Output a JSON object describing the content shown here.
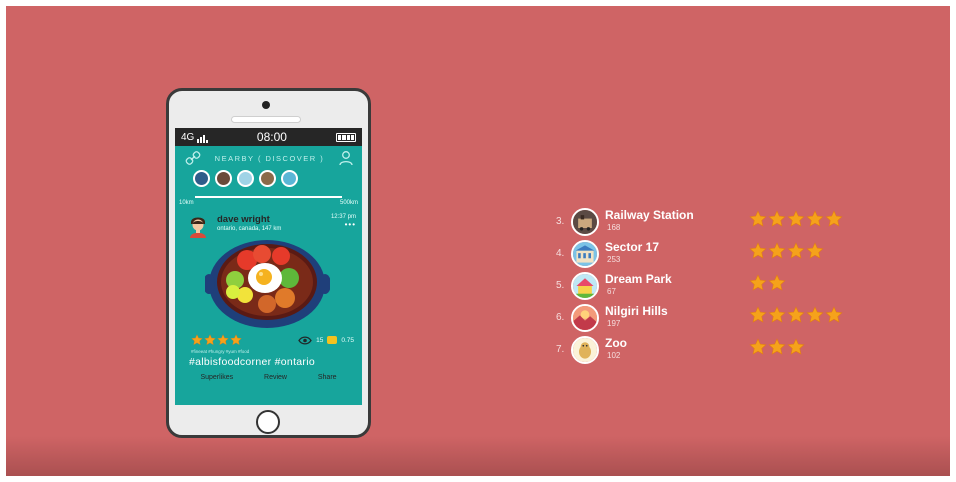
{
  "phone": {
    "status_bar": {
      "network": "4G",
      "time": "08:00"
    },
    "nav": {
      "title": "NEARBY ( DISCOVER )"
    },
    "filter_avatars": [
      "avatar-1",
      "avatar-2",
      "avatar-3",
      "avatar-4",
      "avatar-5"
    ],
    "range": {
      "min_label": "10km",
      "max_label": "500km"
    },
    "post": {
      "user": "dave wright",
      "location": "ontario, canada, 147 km",
      "time": "12:37 pm",
      "more": "•••",
      "rating": 4,
      "views": "15",
      "coins": "0.75",
      "caption": "#fineeat #hungry #yum #food",
      "hashtags": "#albisfoodcorner  #ontario",
      "actions": [
        "Superlikes",
        "Review",
        "Share"
      ]
    }
  },
  "rankings": [
    {
      "rank": "3.",
      "name": "Railway Station",
      "count": "168",
      "stars": 5,
      "icon": "train-icon"
    },
    {
      "rank": "4.",
      "name": "Sector 17",
      "count": "253",
      "stars": 4,
      "icon": "building-icon"
    },
    {
      "rank": "5.",
      "name": "Dream Park",
      "count": "67",
      "stars": 2,
      "icon": "park-icon"
    },
    {
      "rank": "6.",
      "name": "Nilgiri Hills",
      "count": "197",
      "stars": 5,
      "icon": "hills-icon"
    },
    {
      "rank": "7.",
      "name": "Zoo",
      "count": "102",
      "stars": 3,
      "icon": "zoo-icon"
    }
  ],
  "colors": {
    "background": "#cf6465",
    "screen": "#17a59c",
    "star": "#f5a21b"
  }
}
